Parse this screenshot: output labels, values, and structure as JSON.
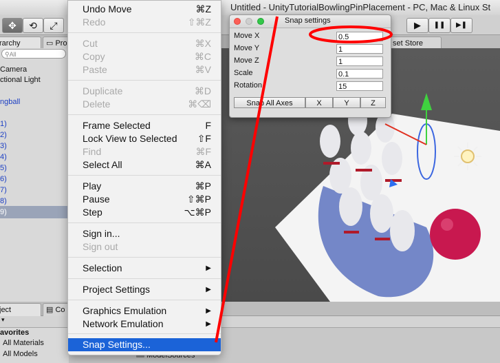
{
  "window": {
    "title": "Untitled - UnityTutorialBowlingPinPlacement - PC, Mac & Linux St"
  },
  "toolbar": {
    "tools": [
      {
        "name": "move-tool",
        "glyph": "✥"
      },
      {
        "name": "rotate-tool",
        "glyph": "⟲"
      },
      {
        "name": "scale-tool",
        "glyph": "⤢"
      }
    ],
    "play": "▶",
    "pause": "❚❚",
    "step": "▶❚"
  },
  "tabs": {
    "hierarchy": "rarchy",
    "project_tab_top": "Pro",
    "asset_store": "set Store",
    "project": "ject",
    "console": "Co"
  },
  "hierarchy": {
    "search_placeholder": "All",
    "items": [
      "Camera",
      "ctional Light",
      "ngball",
      "1)",
      "2)",
      "3)",
      "4)",
      "5)",
      "6)",
      "7)",
      "8)",
      "9)"
    ]
  },
  "project": {
    "favorites": "avorites",
    "items": [
      "All Materials",
      "All Models"
    ],
    "folder": "ModelSources"
  },
  "menu": {
    "items": [
      {
        "label": "Undo Move",
        "shortcut": "⌘Z",
        "disabled": false
      },
      {
        "label": "Redo",
        "shortcut": "⇧⌘Z",
        "disabled": true
      },
      {
        "label": "Cut",
        "shortcut": "⌘X",
        "disabled": true
      },
      {
        "label": "Copy",
        "shortcut": "⌘C",
        "disabled": true
      },
      {
        "label": "Paste",
        "shortcut": "⌘V",
        "disabled": true
      },
      {
        "label": "Duplicate",
        "shortcut": "⌘D",
        "disabled": true
      },
      {
        "label": "Delete",
        "shortcut": "⌘⌫",
        "disabled": true
      },
      {
        "label": "Frame Selected",
        "shortcut": "F",
        "disabled": false
      },
      {
        "label": "Lock View to Selected",
        "shortcut": "⇧F",
        "disabled": false
      },
      {
        "label": "Find",
        "shortcut": "⌘F",
        "disabled": true
      },
      {
        "label": "Select All",
        "shortcut": "⌘A",
        "disabled": false
      },
      {
        "label": "Play",
        "shortcut": "⌘P",
        "disabled": false
      },
      {
        "label": "Pause",
        "shortcut": "⇧⌘P",
        "disabled": false
      },
      {
        "label": "Step",
        "shortcut": "⌥⌘P",
        "disabled": false
      },
      {
        "label": "Sign in...",
        "shortcut": "",
        "disabled": false
      },
      {
        "label": "Sign out",
        "shortcut": "",
        "disabled": true
      },
      {
        "label": "Selection",
        "shortcut": "▶",
        "disabled": false
      },
      {
        "label": "Project Settings",
        "shortcut": "▶",
        "disabled": false
      },
      {
        "label": "Graphics Emulation",
        "shortcut": "▶",
        "disabled": false
      },
      {
        "label": "Network Emulation",
        "shortcut": "▶",
        "disabled": false
      },
      {
        "label": "Snap Settings...",
        "shortcut": "",
        "disabled": false,
        "selected": true
      }
    ]
  },
  "snap": {
    "title": "Snap settings",
    "fields": [
      {
        "label": "Move X",
        "value": "0.5"
      },
      {
        "label": "Move Y",
        "value": "1"
      },
      {
        "label": "Move Z",
        "value": "1"
      },
      {
        "label": "Scale",
        "value": "0.1"
      },
      {
        "label": "Rotation",
        "value": "15"
      }
    ],
    "buttons": {
      "all": "Snap All Axes",
      "x": "X",
      "y": "Y",
      "z": "Z"
    }
  },
  "colors": {
    "menu_highlight": "#1b63d8",
    "annotation": "#ff0000",
    "ball": "#c8184f",
    "pin": "#e8e8ec",
    "stripe": "#b01a2a",
    "selection_row": "#9aa4b8"
  }
}
